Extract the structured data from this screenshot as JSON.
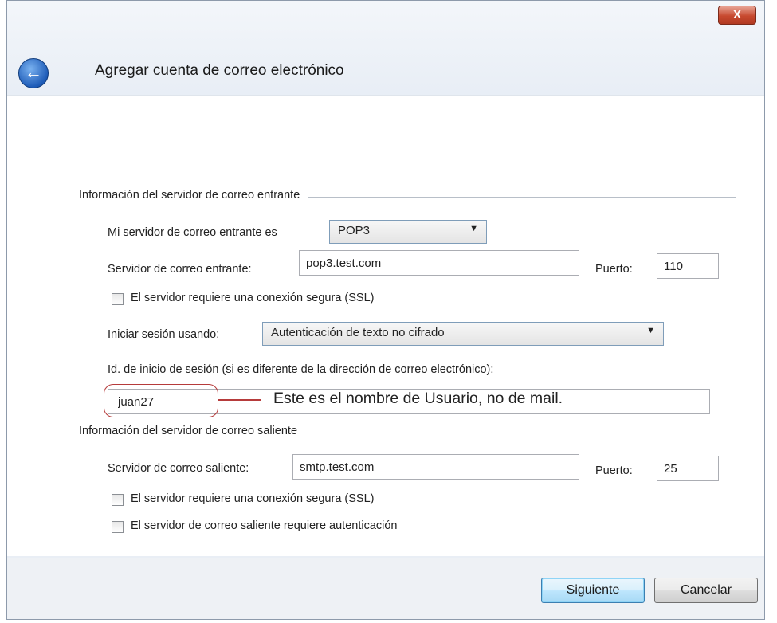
{
  "dialog": {
    "title": "Agregar cuenta de correo electrónico",
    "close_glyph": "X",
    "back_glyph": "←"
  },
  "incoming": {
    "section_title": "Información del servidor de correo entrante",
    "type_label": "Mi servidor de correo entrante es",
    "type_value": "POP3",
    "server_label": "Servidor de correo entrante:",
    "server_value": "pop3.test.com",
    "port_label": "Puerto:",
    "port_value": "110",
    "ssl_label": "El servidor requiere una conexión segura (SSL)",
    "logon_label": "Iniciar sesión usando:",
    "logon_value": "Autenticación de texto no cifrado",
    "id_label": "Id. de inicio de sesión (si es diferente de la dirección de correo electrónico):",
    "id_value": "juan27"
  },
  "annotation": {
    "text": "Este es el nombre de Usuario, no de mail."
  },
  "outgoing": {
    "section_title": "Información del servidor de correo saliente",
    "server_label": "Servidor de correo saliente:",
    "server_value": "smtp.test.com",
    "port_label": "Puerto:",
    "port_value": "25",
    "ssl_label": "El servidor requiere una conexión segura (SSL)",
    "auth_label": "El servidor de correo saliente requiere autenticación"
  },
  "buttons": {
    "next": "Siguiente",
    "cancel": "Cancelar"
  },
  "icons": {
    "back": "back-arrow-icon",
    "close": "close-icon",
    "dropdown": "chevron-down-icon"
  }
}
